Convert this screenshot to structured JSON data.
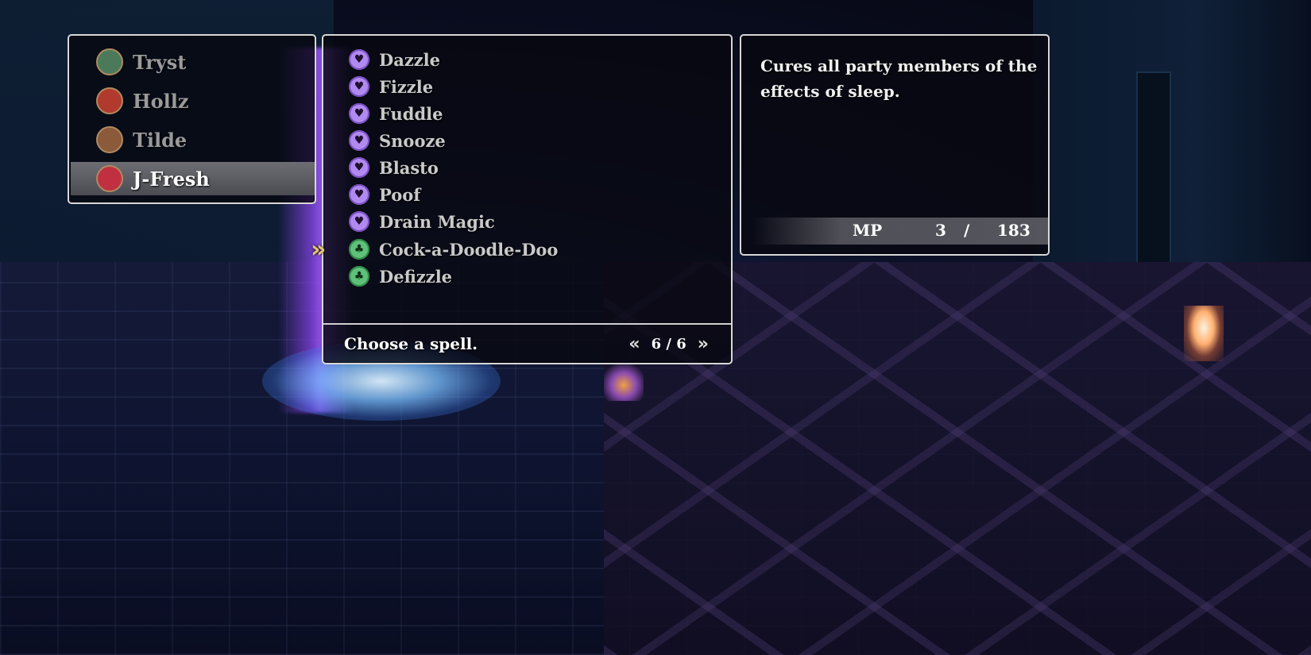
{
  "party": {
    "members": [
      {
        "name": "Tryst",
        "avatar_color": "#4a7a5a"
      },
      {
        "name": "Hollz",
        "avatar_color": "#b03a2e"
      },
      {
        "name": "Tilde",
        "avatar_color": "#8a5a3a"
      },
      {
        "name": "J-Fresh",
        "avatar_color": "#c03040"
      }
    ],
    "selected": "J-Fresh"
  },
  "spells": {
    "items": [
      {
        "name": "Dazzle",
        "icon": "purple-spell-icon"
      },
      {
        "name": "Fizzle",
        "icon": "purple-spell-icon"
      },
      {
        "name": "Fuddle",
        "icon": "purple-spell-icon"
      },
      {
        "name": "Snooze",
        "icon": "purple-spell-icon"
      },
      {
        "name": "Blasto",
        "icon": "purple-spell-icon"
      },
      {
        "name": "Poof",
        "icon": "purple-spell-icon"
      },
      {
        "name": "Drain Magic",
        "icon": "purple-spell-icon"
      },
      {
        "name": "Cock-a-Doodle-Doo",
        "icon": "green-spell-icon"
      },
      {
        "name": "Defizzle",
        "icon": "green-spell-icon"
      }
    ],
    "selected": "Cock-a-Doodle-Doo",
    "prompt": "Choose a spell.",
    "page": "6 / 6"
  },
  "description": {
    "text": "Cures all party members of the effects of sleep.",
    "mp_label": "MP",
    "mp_current": "3",
    "mp_separator": "/",
    "mp_max": "183"
  },
  "colors": {
    "panel_border": "#d8d8d8",
    "selected_row": "#5a5a62",
    "cursor": "#e8c86a",
    "purple_icon": "#b18af0",
    "green_icon": "#5fc07a"
  }
}
